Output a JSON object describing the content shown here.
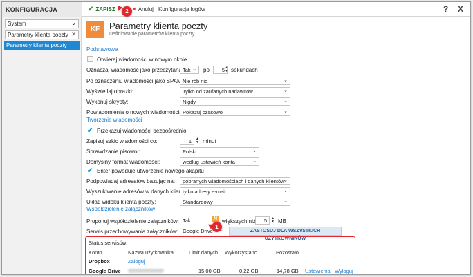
{
  "app_title": "KONFIGURACJA",
  "toolbar": {
    "save": "ZAPISZ",
    "cancel": "Anuluj",
    "log_config": "Konfiguracja logów",
    "help": "?",
    "close": "X"
  },
  "sidebar": {
    "module": "System",
    "search": "Parametry klienta poczty",
    "items": [
      {
        "label": "Parametry klienta poczty"
      }
    ]
  },
  "header": {
    "badge": "KF",
    "title": "Parametry klienta poczty",
    "subtitle": "Definiowanie parametrów klienta poczty"
  },
  "sections": {
    "basic": "Podstawowe",
    "compose": "Tworzenie wiadomości",
    "sharing": "Współdzielenie załączników"
  },
  "basic": {
    "open_new_window": "Otwieraj wiadomości w nowym oknie",
    "mark_read_label": "Oznaczaj wiadomość jako przeczytaną:",
    "mark_read_value": "Tak",
    "after": "po",
    "seconds_value": "5",
    "seconds": "sekundach",
    "spam_label": "Po oznaczeniu wiadomości jako SPAM:",
    "spam_value": "Nie rób nic",
    "images_label": "Wyświetlaj obrazki:",
    "images_value": "Tylko od zaufanych nadawców",
    "scripts_label": "Wykonuj skrypty:",
    "scripts_value": "Nigdy",
    "notif_label": "Powiadomienia o nowych wiadomościach:",
    "notif_value": "Pokazuj czasowo"
  },
  "compose": {
    "forward_direct": "Przekazuj wiadomości bezpośrednio",
    "draft_label": "Zapisuj szkic wiadomości co:",
    "draft_value": "1",
    "minutes": "minut",
    "spell_label": "Sprawdzanie pisowni:",
    "spell_value": "Polski",
    "format_label": "Domyślny format wiadomości:",
    "format_value": "według ustawień konta",
    "enter_paragraph": "Enter powoduje utworzenie nowego akapitu",
    "suggest_label": "Podpowiadaj adresatów bazując na:",
    "suggest_value": "pobranych wiadomościach i danych klientów",
    "search_label": "Wyszukiwanie adresów w danych klientów:",
    "search_value": "tylko adresy e-mail",
    "layout_label": "Układ widoku klienta poczty:",
    "layout_value": "Standardowy"
  },
  "sharing": {
    "propose_label": "Proponuj współdzielenie załączników:",
    "propose_value": "Tak",
    "badge": "N",
    "larger_than": "większych niż:",
    "size_value": "5",
    "unit": "MB",
    "service_label": "Serwis przechowywania załączników:",
    "service_value": "Google Drive",
    "apply_all": "ZASTOSUJ DLA WSZYSTKICH UŻYTKOWNIKÓW"
  },
  "status": {
    "title": "Status serwisów:",
    "columns": [
      "Konto",
      "Nazwa użytkownika",
      "Limit danych",
      "Wykorzystano",
      "Pozostało"
    ],
    "rows": [
      {
        "account": "Dropbox",
        "user": "Zaloguj",
        "limit": "",
        "used": "",
        "left": "",
        "settings": "",
        "logout": ""
      },
      {
        "account": "Google Drive",
        "user": "",
        "limit": "15,00 GB",
        "used": "0,22 GB",
        "left": "14,78 GB",
        "settings": "Ustawienia",
        "logout": "Wyloguj"
      }
    ]
  },
  "markers": {
    "one": "1",
    "two": "2"
  },
  "colors": {
    "accent": "#1e88d4",
    "highlight": "#e0282e",
    "badge": "#ef8b3c"
  }
}
